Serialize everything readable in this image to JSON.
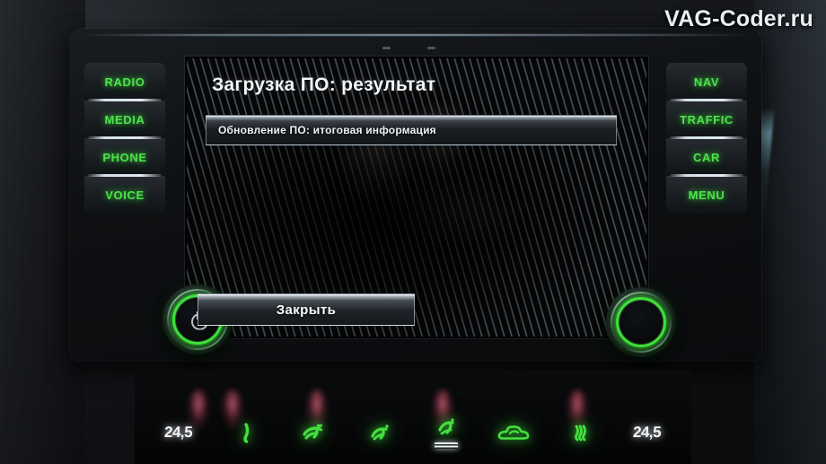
{
  "watermark": {
    "text": "VAG-Coder.ru"
  },
  "screen": {
    "title": "Загрузка ПО: результат",
    "info_bar": {
      "text": "Обновление ПО: итоговая информация"
    },
    "close_button": {
      "label": "Закрыть"
    }
  },
  "left_keys": [
    {
      "label": "RADIO",
      "name": "hardkey-radio"
    },
    {
      "label": "MEDIA",
      "name": "hardkey-media"
    },
    {
      "label": "PHONE",
      "name": "hardkey-phone"
    },
    {
      "label": "VOICE",
      "name": "hardkey-voice"
    }
  ],
  "right_keys": [
    {
      "label": "NAV",
      "name": "hardkey-nav"
    },
    {
      "label": "TRAFFIC",
      "name": "hardkey-traffic"
    },
    {
      "label": "CAR",
      "name": "hardkey-car"
    },
    {
      "label": "MENU",
      "name": "hardkey-menu"
    }
  ],
  "knobs": {
    "left": {
      "name": "power-volume-knob",
      "glyph": "power-icon"
    },
    "right": {
      "name": "tune-scroll-knob"
    }
  },
  "climate": {
    "left_temperature": "24,5",
    "right_temperature": "24,5",
    "controls": [
      {
        "name": "windshield-defrost-icon",
        "icon": "defrost-windshield"
      },
      {
        "name": "front-defrost-icon",
        "icon": "defrost-front"
      },
      {
        "name": "airflow-face-icon",
        "icon": "airflow-face"
      },
      {
        "name": "airflow-feet-icon",
        "icon": "airflow-feet"
      },
      {
        "name": "recirculation-icon",
        "icon": "recirculation-car"
      },
      {
        "name": "rear-window-heater-icon",
        "icon": "rear-defrost"
      }
    ]
  },
  "colors": {
    "key_green": "#4ee24a",
    "knob_ring_green": "#3ee13a",
    "climate_green": "#45e03f",
    "screen_text": "#f2f5f8"
  }
}
